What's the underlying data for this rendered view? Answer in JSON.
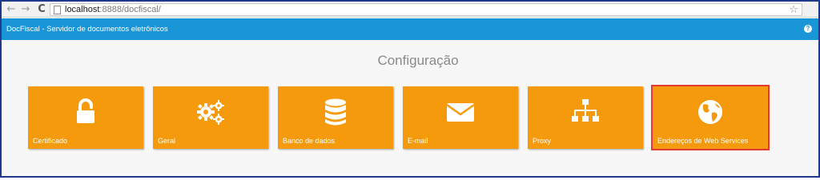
{
  "browser": {
    "url_host": "localhost",
    "url_path": ":8888/docfiscal/"
  },
  "header": {
    "title": "DocFiscal - Servidor de documentos eletrônicos"
  },
  "main": {
    "title": "Configuração",
    "tiles": [
      {
        "label": "Certificado",
        "icon": "unlock-icon"
      },
      {
        "label": "Geral",
        "icon": "gears-icon"
      },
      {
        "label": "Banco de dados",
        "icon": "database-icon"
      },
      {
        "label": "E-mail",
        "icon": "envelope-icon"
      },
      {
        "label": "Proxy",
        "icon": "sitemap-icon"
      },
      {
        "label": "Endereços de Web Services",
        "icon": "globe-icon",
        "selected": true
      }
    ]
  },
  "colors": {
    "tile": "#f59a0d",
    "header": "#1a96d8",
    "selected_outline": "#e53935"
  }
}
